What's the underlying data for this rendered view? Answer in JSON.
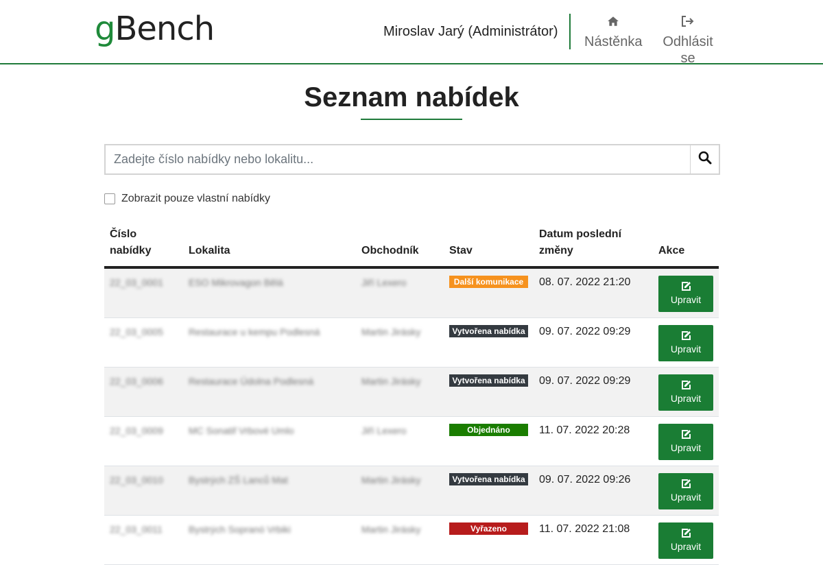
{
  "app": {
    "logo_g": "g",
    "logo_rest": "Bench"
  },
  "header": {
    "user": "Miroslav Jarý (Administrátor)",
    "nav_dashboard": "Nástěnka",
    "nav_logout": "Odhlásit se"
  },
  "page": {
    "title": "Seznam nabídek"
  },
  "search": {
    "placeholder": "Zadejte číslo nabídky nebo lokalitu..."
  },
  "filter": {
    "own_only_label": "Zobrazit pouze vlastní nabídky",
    "checked": false
  },
  "table": {
    "headers": {
      "number": "Číslo nabídky",
      "location": "Lokalita",
      "salesman": "Obchodník",
      "status": "Stav",
      "last_change": "Datum poslední změny",
      "action": "Akce"
    },
    "edit_label": "Upravit",
    "rows": [
      {
        "number": "22_03_0001",
        "location": "ESO Mikrovagon Bělá",
        "salesman": "Jiří Lexero",
        "status": "Další komunikace",
        "status_color": "#f6921e",
        "date": "08. 07. 2022 21:20"
      },
      {
        "number": "22_03_0005",
        "location": "Restaurace u kempu Podlesná",
        "salesman": "Martin Jirásky",
        "status": "Vytvořena nabídka",
        "status_color": "#343a40",
        "date": "09. 07. 2022 09:29"
      },
      {
        "number": "22_03_0006",
        "location": "Restaurace Údolna Podlesná",
        "salesman": "Martin Jirásky",
        "status": "Vytvořena nabídka",
        "status_color": "#343a40",
        "date": "09. 07. 2022 09:29"
      },
      {
        "number": "22_03_0009",
        "location": "MC Sonatif Vrbové Umlo",
        "salesman": "Jiří Lexero",
        "status": "Objednáno",
        "status_color": "#1a7d00",
        "date": "11. 07. 2022 20:28"
      },
      {
        "number": "22_03_0010",
        "location": "Bystrých ZŠ Lanců Mat",
        "salesman": "Martin Jirásky",
        "status": "Vytvořena nabídka",
        "status_color": "#343a40",
        "date": "09. 07. 2022 09:26"
      },
      {
        "number": "22_03_0011",
        "location": "Bystrých Sopranó Vrbiki",
        "salesman": "Martin Jirásky",
        "status": "Vyřazeno",
        "status_color": "#b71c1c",
        "date": "11. 07. 2022 21:08"
      }
    ]
  }
}
